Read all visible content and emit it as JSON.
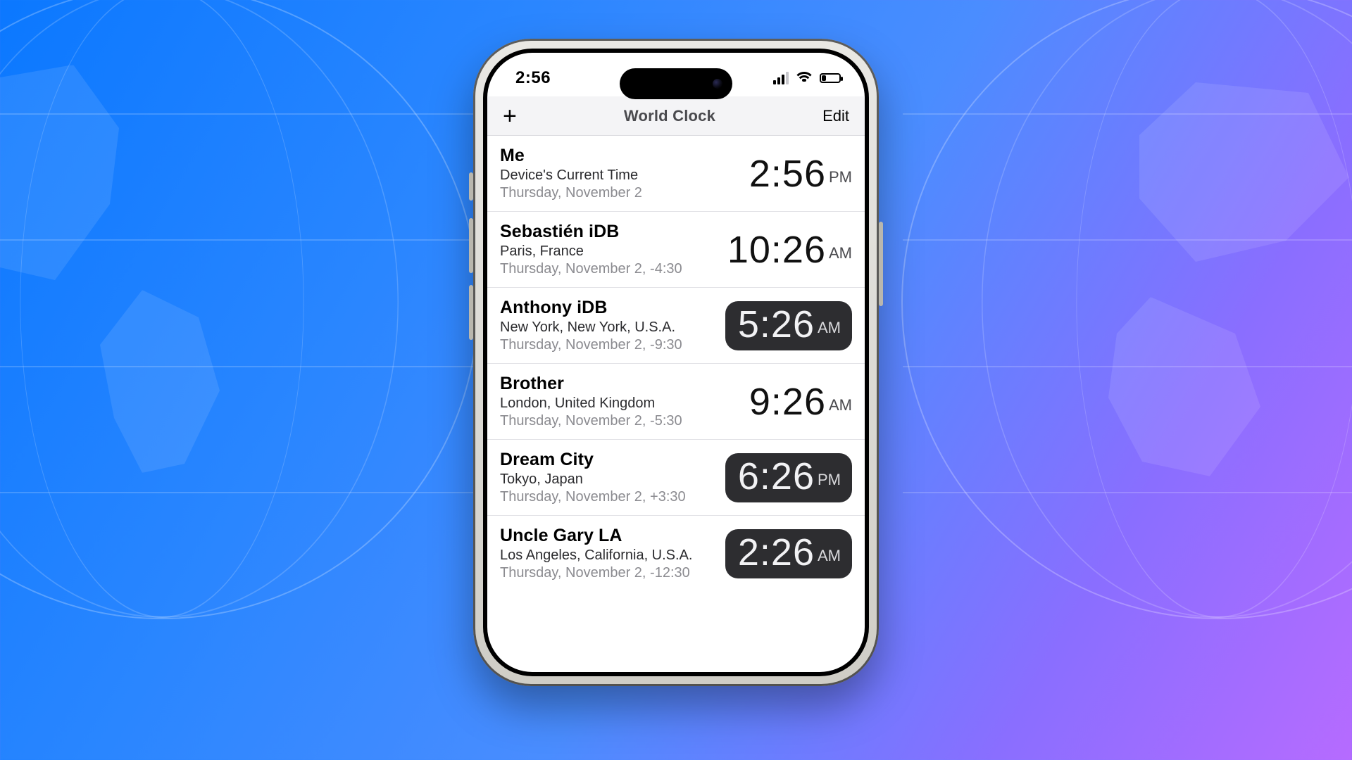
{
  "statusbar": {
    "time": "2:56"
  },
  "nav": {
    "title": "World Clock",
    "edit_label": "Edit"
  },
  "entries": [
    {
      "name": "Me",
      "location": "Device's Current Time",
      "meta": "Thursday, November 2",
      "time": "2:56",
      "ampm": "PM",
      "pill": false
    },
    {
      "name": "Sebastién iDB",
      "location": "Paris, France",
      "meta": "Thursday, November 2, -4:30",
      "time": "10:26",
      "ampm": "AM",
      "pill": false
    },
    {
      "name": "Anthony iDB",
      "location": "New York, New York, U.S.A.",
      "meta": "Thursday, November 2, -9:30",
      "time": "5:26",
      "ampm": "AM",
      "pill": true
    },
    {
      "name": "Brother",
      "location": "London, United Kingdom",
      "meta": "Thursday, November 2, -5:30",
      "time": "9:26",
      "ampm": "AM",
      "pill": false
    },
    {
      "name": "Dream City",
      "location": "Tokyo, Japan",
      "meta": "Thursday, November 2, +3:30",
      "time": "6:26",
      "ampm": "PM",
      "pill": true
    },
    {
      "name": "Uncle Gary LA",
      "location": "Los Angeles, California, U.S.A.",
      "meta": "Thursday, November 2, -12:30",
      "time": "2:26",
      "ampm": "AM",
      "pill": true
    }
  ]
}
